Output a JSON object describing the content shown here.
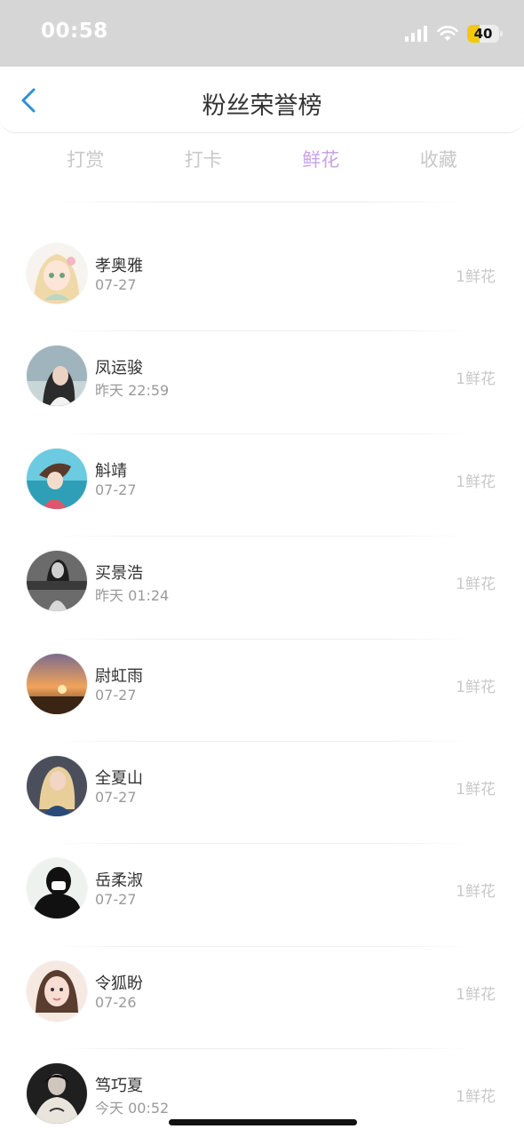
{
  "status_bar": {
    "time": "00:58",
    "battery": "40",
    "battery_color": "#f2c811"
  },
  "nav": {
    "title": "粉丝荣誉榜",
    "back_icon": "chevron-left-icon",
    "accent": "#2f8fd8"
  },
  "tabs": [
    {
      "label": "打赏",
      "active": false
    },
    {
      "label": "打卡",
      "active": false
    },
    {
      "label": "鲜花",
      "active": true
    },
    {
      "label": "收藏",
      "active": false
    }
  ],
  "tab_active_color": "#c9a3e6",
  "fans": [
    {
      "name": "孝奥雅",
      "time": "07-27",
      "count": "1鲜花",
      "avatar": "anime-girl"
    },
    {
      "name": "凤运骏",
      "time": "昨天 22:59",
      "count": "1鲜花",
      "avatar": "woman-portrait"
    },
    {
      "name": "斛靖",
      "time": "07-27",
      "count": "1鲜花",
      "avatar": "anime-character"
    },
    {
      "name": "买景浩",
      "time": "昨天 01:24",
      "count": "1鲜花",
      "avatar": "woman-bw-text"
    },
    {
      "name": "尉虹雨",
      "time": "07-27",
      "count": "1鲜花",
      "avatar": "sunset"
    },
    {
      "name": "全夏山",
      "time": "07-27",
      "count": "1鲜花",
      "avatar": "blonde-woman"
    },
    {
      "name": "岳柔淑",
      "time": "07-27",
      "count": "1鲜花",
      "avatar": "black-masked-figure"
    },
    {
      "name": "令狐盼",
      "time": "07-26",
      "count": "1鲜花",
      "avatar": "woman-selfie"
    },
    {
      "name": "笃巧夏",
      "time": "今天 00:52",
      "count": "1鲜花",
      "avatar": "person-dark-hoodie"
    }
  ]
}
